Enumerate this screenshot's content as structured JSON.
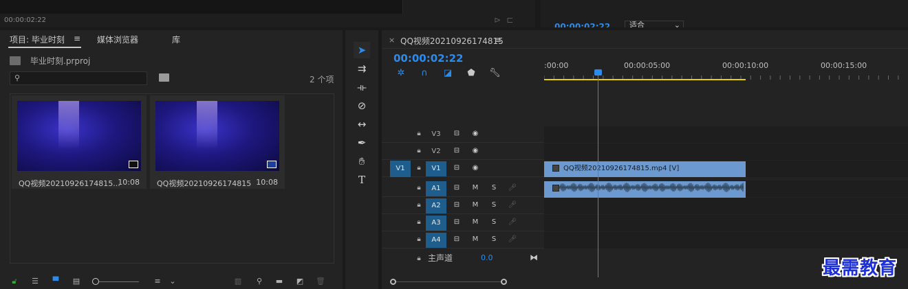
{
  "source_monitor": {
    "timecode": "00:00:02:22"
  },
  "program_monitor": {
    "timecode": "00:00:02:22",
    "fit_label": "适合"
  },
  "project_panel": {
    "tabs": [
      {
        "label": "项目: 毕业时刻",
        "active": true
      },
      {
        "label": "≡"
      },
      {
        "label": "媒体浏览器"
      },
      {
        "label": "库"
      }
    ],
    "project_file": "毕业时刻.prproj",
    "search": {
      "value": "",
      "placeholder": ""
    },
    "item_count": "2 个项",
    "clips": [
      {
        "name": "QQ视频20210926174815...",
        "duration": "10:08",
        "badge": "sequence-icon"
      },
      {
        "name": "QQ视频20210926174815",
        "duration": "10:08",
        "badge": "clip-icon"
      }
    ]
  },
  "timeline": {
    "sequence_name": "QQ视频20210926174815",
    "close": "×",
    "menu": "≡",
    "timecode": "00:00:02:22",
    "ruler_labels": [
      ":00:00",
      "00:00:05:00",
      "00:00:10:00",
      "00:00:15:00"
    ],
    "tracks": {
      "video": [
        {
          "name": "V3",
          "selected": false
        },
        {
          "name": "V2",
          "selected": false
        },
        {
          "name": "V1",
          "selected": true,
          "source": "V1"
        }
      ],
      "audio": [
        {
          "name": "A1",
          "m": "M",
          "s": "S"
        },
        {
          "name": "A2",
          "m": "M",
          "s": "S"
        },
        {
          "name": "A3",
          "m": "M",
          "s": "S"
        },
        {
          "name": "A4",
          "m": "M",
          "s": "S"
        }
      ]
    },
    "video_clip_label": "QQ视频20210926174815.mp4 [V]",
    "master": {
      "label": "主声道",
      "value": "0.0"
    }
  },
  "watermark": "最需教育",
  "colors": {
    "accent": "#2d8ceb",
    "clip": "#6c9ad0",
    "work_area": "#e6d200",
    "track_select": "#1f5d8c"
  }
}
